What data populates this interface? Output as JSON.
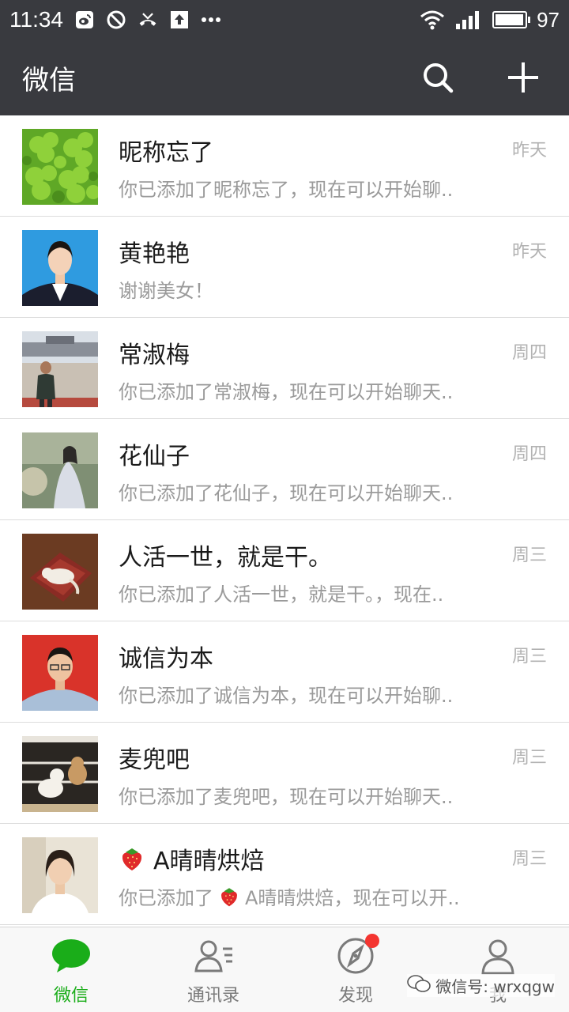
{
  "status_bar": {
    "time": "11:34",
    "battery": "97",
    "battery_level": 0.97,
    "icons": [
      "weibo-icon",
      "blocked-icon",
      "missed-call-icon",
      "upload-icon",
      "more-dots-icon",
      "wifi-icon",
      "signal-icon",
      "battery-icon"
    ]
  },
  "header": {
    "title": "微信",
    "search_icon": "search-icon",
    "add_icon": "plus-icon"
  },
  "chats": [
    {
      "name": "昵称忘了",
      "preview": "你已添加了昵称忘了，现在可以开始聊..",
      "time": "昨天"
    },
    {
      "name": "黄艳艳",
      "preview": "谢谢美女！",
      "time": "昨天"
    },
    {
      "name": "常淑梅",
      "preview": "你已添加了常淑梅，现在可以开始聊天..",
      "time": "周四"
    },
    {
      "name": "花仙子",
      "preview": "你已添加了花仙子，现在可以开始聊天..",
      "time": "周四"
    },
    {
      "name": "人活一世，就是干。",
      "preview": "你已添加了人活一世，就是干。，现在..",
      "time": "周三"
    },
    {
      "name": "诚信为本",
      "preview": "你已添加了诚信为本，现在可以开始聊..",
      "time": "周三"
    },
    {
      "name": "麦兜吧",
      "preview": "你已添加了麦兜吧，现在可以开始聊天..",
      "time": "周三"
    },
    {
      "name": "A晴晴烘焙",
      "name_emoji": "strawberry-icon",
      "preview_prefix": "你已添加了",
      "preview_suffix": "A晴晴烘焙，现在可以开..",
      "time": "周三"
    }
  ],
  "tabs": [
    {
      "label": "微信",
      "icon": "chat-bubble-icon",
      "active": true
    },
    {
      "label": "通讯录",
      "icon": "contacts-icon",
      "active": false
    },
    {
      "label": "发现",
      "icon": "compass-icon",
      "active": false,
      "badge": true
    },
    {
      "label": "我",
      "icon": "person-icon",
      "active": false
    }
  ],
  "watermark": {
    "text": "微信号: wrxqgw"
  },
  "colors": {
    "header_bg": "#393a3f",
    "accent_green": "#1aad19",
    "badge_red": "#f43530"
  }
}
